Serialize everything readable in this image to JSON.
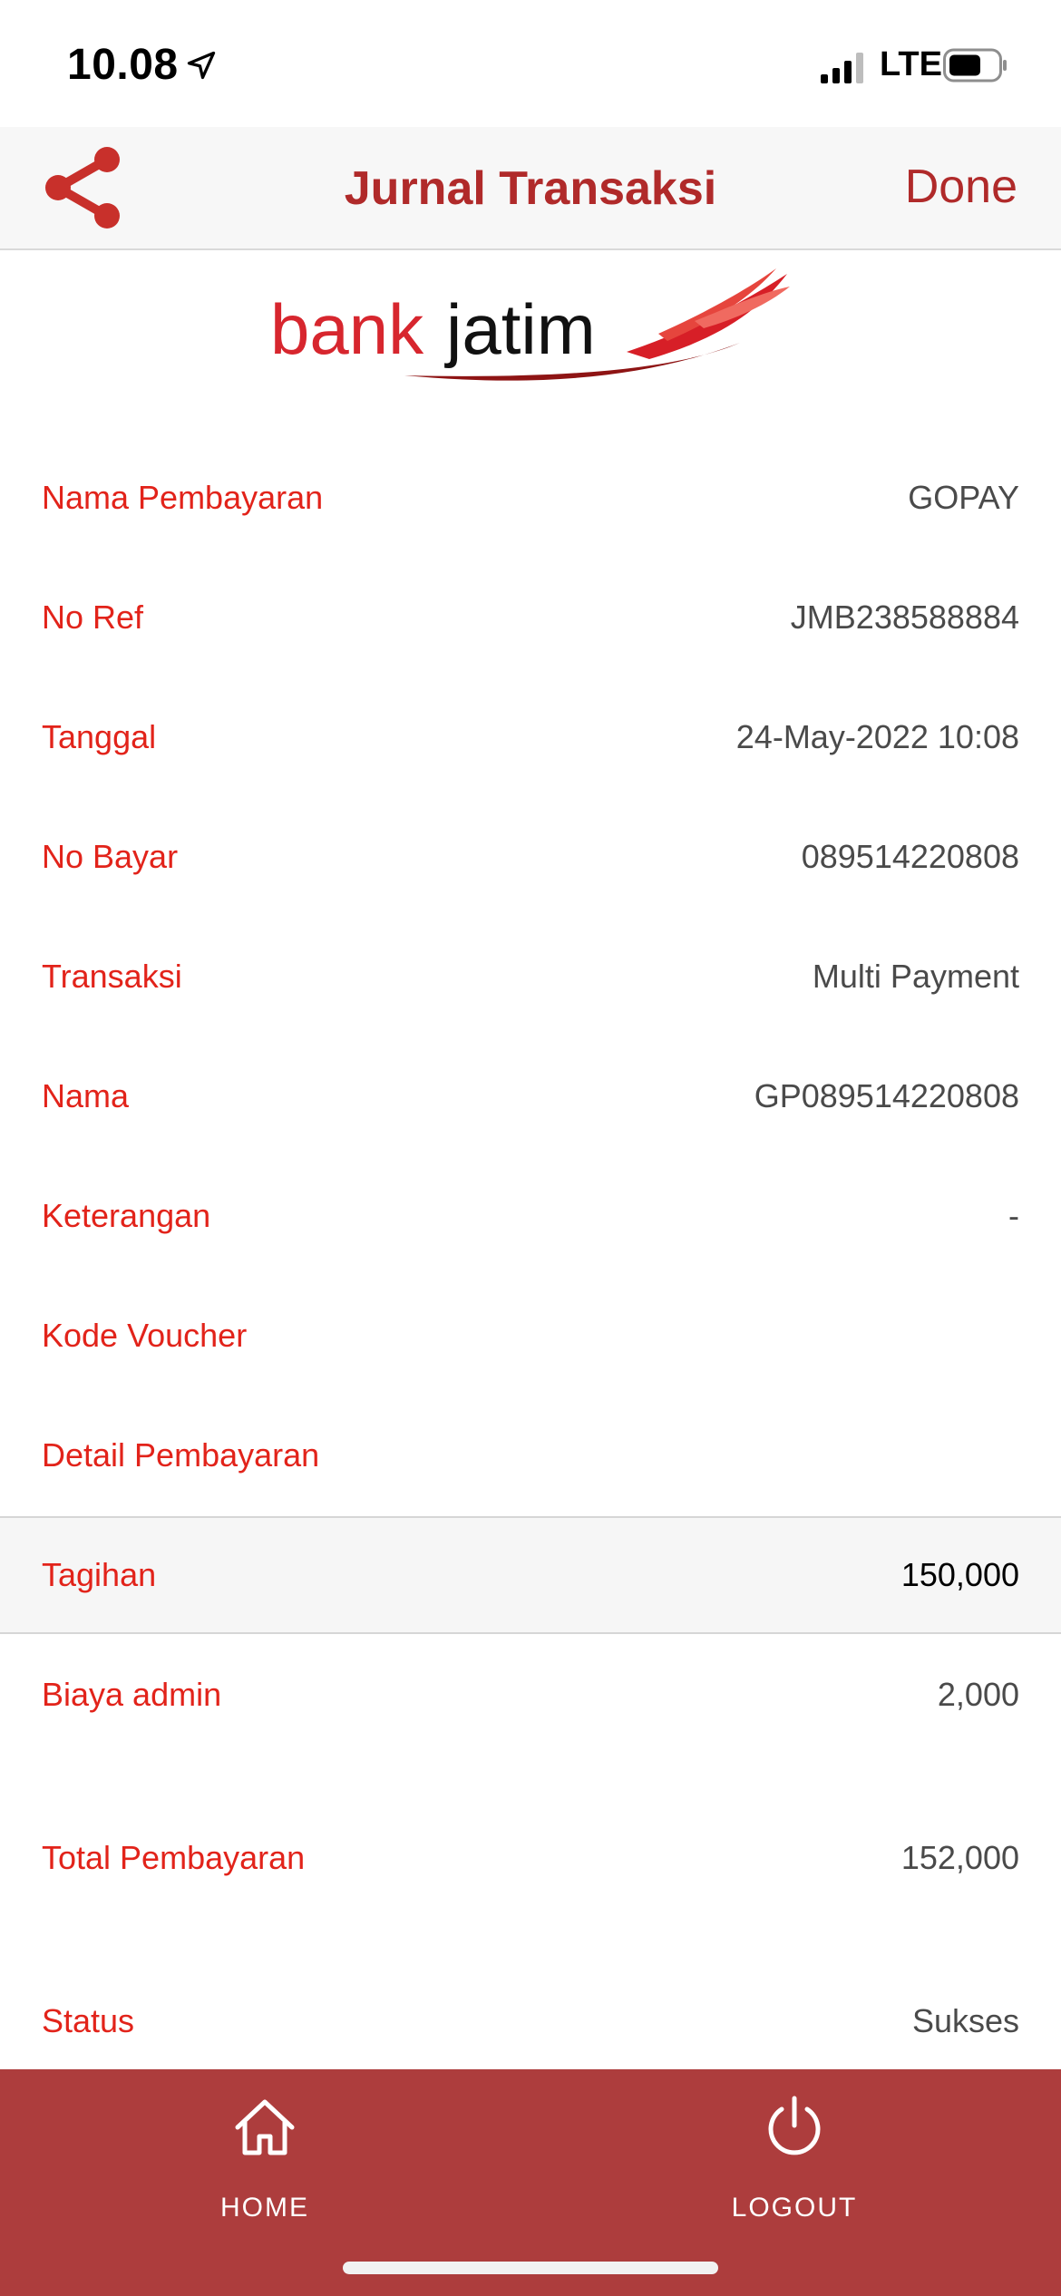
{
  "status_bar": {
    "time": "10.08",
    "network": "LTE"
  },
  "navbar": {
    "title": "Jurnal Transaksi",
    "done_label": "Done",
    "share_icon": "share-icon"
  },
  "logo": {
    "text_bank": "bank",
    "text_jatim": "jatim"
  },
  "details": [
    {
      "label": "Nama Pembayaran",
      "value": "GOPAY"
    },
    {
      "label": "No Ref",
      "value": "JMB238588884"
    },
    {
      "label": "Tanggal",
      "value": "24-May-2022 10:08"
    },
    {
      "label": "No Bayar",
      "value": "089514220808"
    },
    {
      "label": "Transaksi",
      "value": "Multi Payment"
    },
    {
      "label": "Nama",
      "value": "GP089514220808"
    },
    {
      "label": "Keterangan",
      "value": "-"
    },
    {
      "label": "Kode Voucher",
      "value": ""
    },
    {
      "label": "Detail Pembayaran",
      "value": ""
    },
    {
      "label": "Tagihan",
      "value": "150,000"
    },
    {
      "label": "Biaya admin",
      "value": "2,000"
    },
    {
      "label": "Total Pembayaran",
      "value": "152,000"
    },
    {
      "label": "Status",
      "value": "Sukses"
    }
  ],
  "tabbar": {
    "home_label": "HOME",
    "logout_label": "LOGOUT"
  },
  "colors": {
    "accent": "#b02a2a",
    "label_red": "#e2231a",
    "tabbar_bg": "#ad3d3d"
  }
}
